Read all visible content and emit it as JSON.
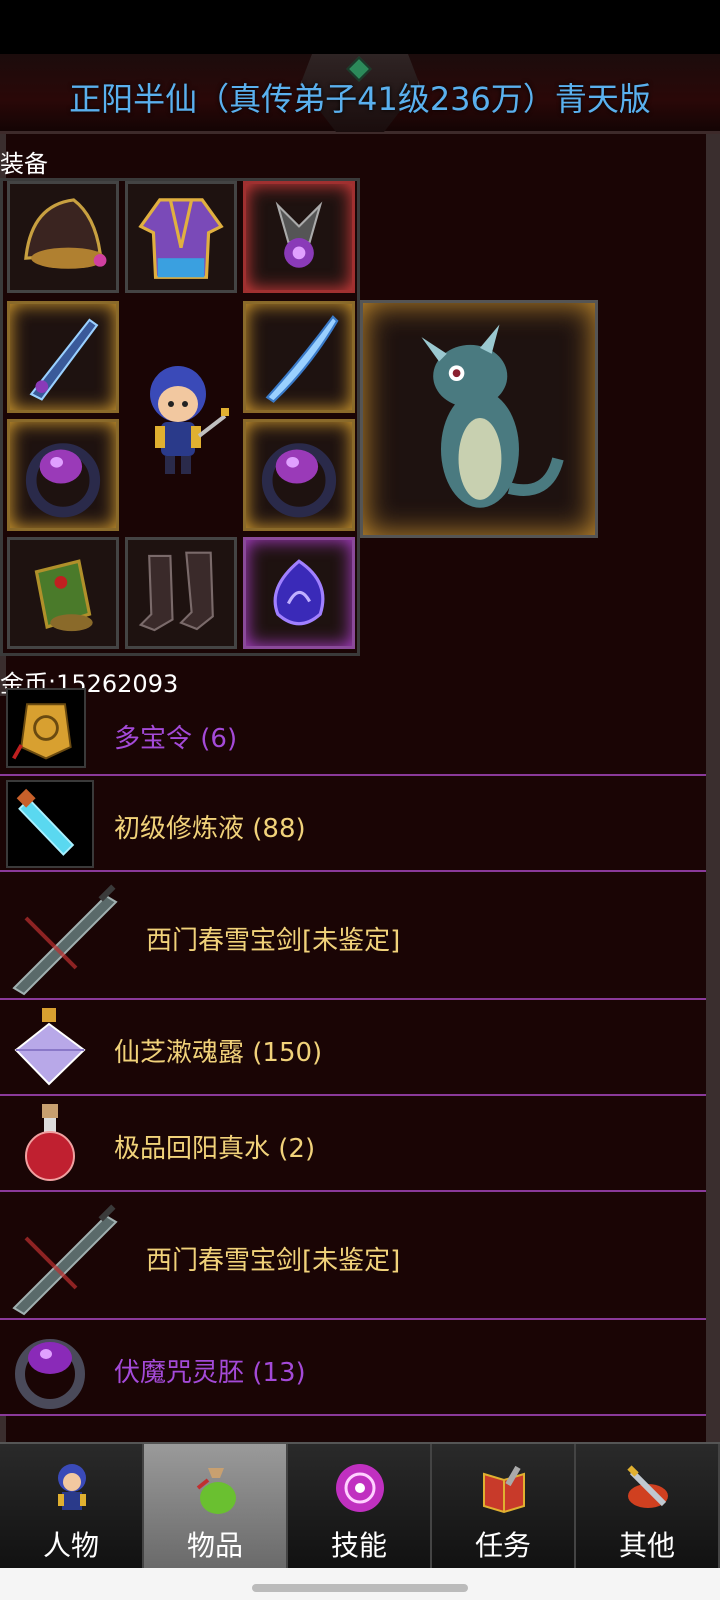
{
  "title": "正阳半仙（真传弟子41级236万）青天版",
  "equipment": {
    "section_label": "装备",
    "slots": [
      {
        "name": "hat-icon"
      },
      {
        "name": "robe-icon"
      },
      {
        "name": "amulet-icon"
      },
      {
        "name": "weapon-left-icon"
      },
      {
        "name": "weapon-right-icon"
      },
      {
        "name": "ring-left-icon"
      },
      {
        "name": "ring-right-icon"
      },
      {
        "name": "bracer-icon"
      },
      {
        "name": "boots-icon"
      },
      {
        "name": "orb-icon"
      }
    ],
    "pet": "dragon-pet-icon"
  },
  "gold": "金币:15262093",
  "items": [
    {
      "label": "多宝令 (6)",
      "icon": "token-icon",
      "color": "#a44ad8"
    },
    {
      "label": "初级修炼液 (88)",
      "icon": "potion-vial-icon",
      "color": "#f1d27a"
    },
    {
      "label": "西门春雪宝剑[未鉴定]",
      "icon": "sword-icon",
      "color": "#f1d27a"
    },
    {
      "label": "仙芝漱魂露 (150)",
      "icon": "crystal-bottle-icon",
      "color": "#f1d27a"
    },
    {
      "label": "极品回阳真水 (2)",
      "icon": "red-potion-icon",
      "color": "#f1d27a"
    },
    {
      "label": "西门春雪宝剑[未鉴定]",
      "icon": "sword-icon",
      "color": "#f1d27a"
    },
    {
      "label": "伏魔咒灵胚 (13)",
      "icon": "purple-ring-icon",
      "color": "#a44ad8"
    }
  ],
  "tabs": [
    {
      "label": "人物",
      "icon": "character-icon",
      "active": false
    },
    {
      "label": "物品",
      "icon": "bag-icon",
      "active": true
    },
    {
      "label": "技能",
      "icon": "skill-orb-icon",
      "active": false
    },
    {
      "label": "任务",
      "icon": "quest-book-icon",
      "active": false
    },
    {
      "label": "其他",
      "icon": "other-icon",
      "active": false
    }
  ]
}
